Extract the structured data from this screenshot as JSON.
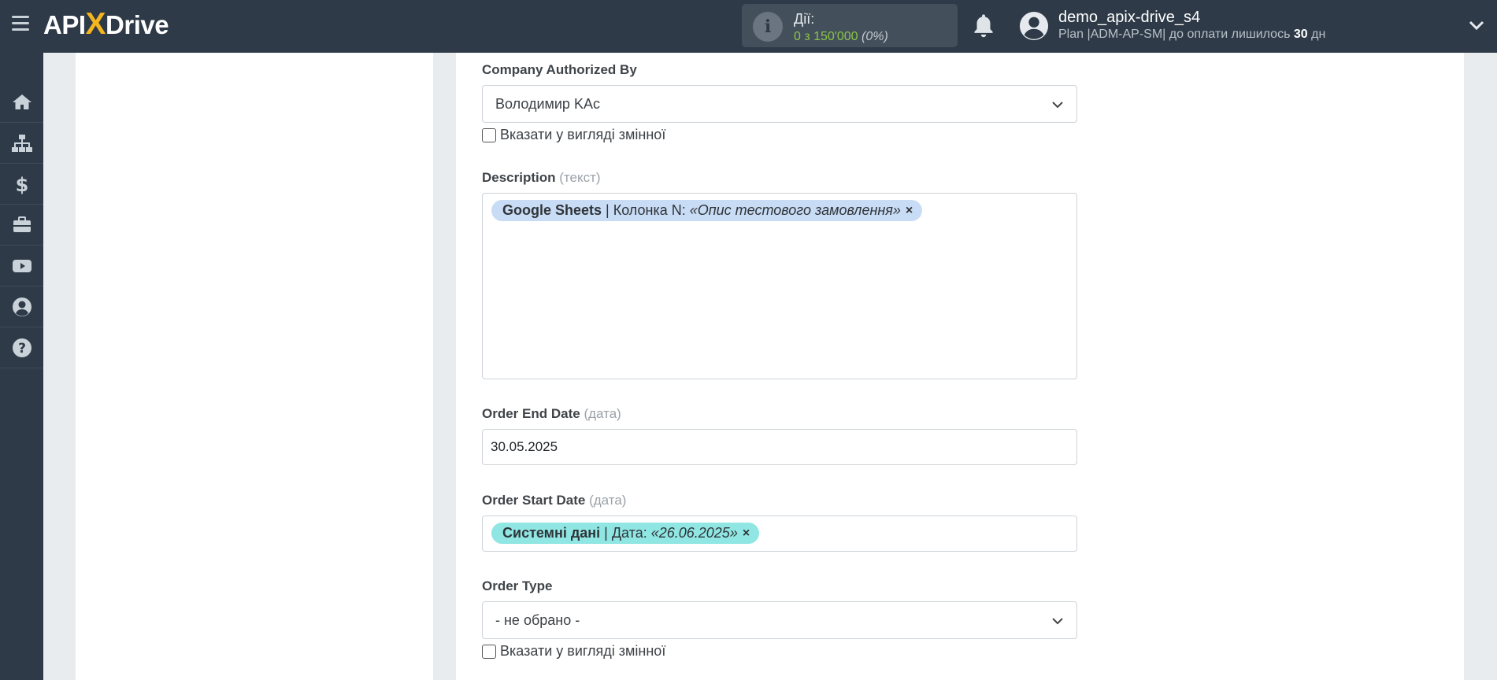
{
  "header": {
    "logo_text_a": "API",
    "logo_text_x": "X",
    "logo_text_b": "Drive",
    "actions_label": "Дії:",
    "actions_value": "0 з 150'000",
    "actions_percent": "(0%)",
    "user_name": "demo_apix-drive_s4",
    "plan_prefix": "Plan |ADM-AP-SM| до оплати лишилось",
    "plan_days": "30",
    "plan_suffix": "дн"
  },
  "sidebar": {
    "items": [
      "home-icon",
      "sitemap-icon",
      "dollar-icon",
      "briefcase-icon",
      "youtube-icon",
      "user-circle-icon",
      "help-icon"
    ]
  },
  "form": {
    "company_authorized_by": {
      "label": "Company Authorized By",
      "value": "Володимир KAc",
      "checkbox_label": "Вказати у вигляді змінної"
    },
    "description": {
      "label": "Description",
      "hint": "(текст)",
      "tag_source": "Google Sheets",
      "tag_field": " | Колонка N: ",
      "tag_value": "«Опис тестового замовлення»",
      "tag_remove": "×"
    },
    "order_end_date": {
      "label": "Order End Date",
      "hint": "(дата)",
      "value": "30.05.2025"
    },
    "order_start_date": {
      "label": "Order Start Date",
      "hint": "(дата)",
      "tag_source": "Системні дані",
      "tag_field": " | Дата: ",
      "tag_value": "«26.06.2025»",
      "tag_remove": "×"
    },
    "order_type": {
      "label": "Order Type",
      "value": "- не обрано -",
      "checkbox_label": "Вказати у вигляді змінної"
    }
  },
  "colors": {
    "topbar": "#2e3a47",
    "accent_yellow": "#f5b51f",
    "actions_green": "#8bc34a",
    "tag_google": "#c9dcf5",
    "tag_system": "#8fe6e3"
  }
}
